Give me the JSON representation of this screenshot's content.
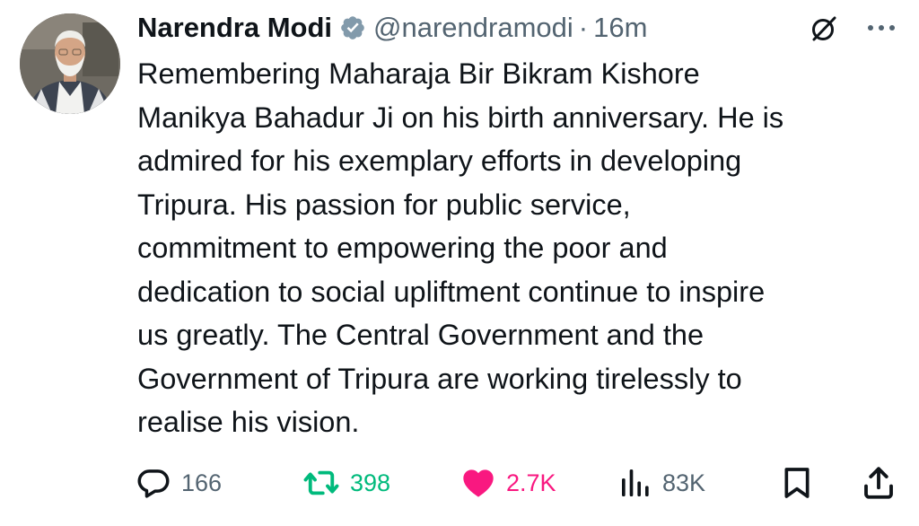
{
  "author": {
    "name": "Narendra Modi",
    "handle": "@narendramodi",
    "separator": "·",
    "timestamp": "16m",
    "verified": true
  },
  "tweet": {
    "lines": [
      "Remembering Maharaja Bir Bikram Kishore",
      "Manikya Bahadur Ji on his birth anniversary. He is",
      "admired for his exemplary efforts in developing",
      "Tripura. His passion for public service,",
      "commitment to empowering the poor and",
      "dedication to social upliftment continue to inspire",
      "us greatly. The Central Government and the",
      "Government of Tripura are working tirelessly to",
      "realise his vision."
    ]
  },
  "actions": {
    "replies": "166",
    "reposts": "398",
    "likes": "2.7K",
    "views": "83K",
    "liked": true
  },
  "colors": {
    "text": "#0f1419",
    "secondary": "#536471",
    "verified_badge": "#829aab",
    "repost": "#00ba7c",
    "like": "#f91880"
  },
  "icons": {
    "reply": "reply-icon",
    "repost": "repost-icon",
    "like": "heart-icon",
    "views": "views-icon",
    "bookmark": "bookmark-icon",
    "share": "share-icon",
    "grok": "grok-icon",
    "more": "more-icon"
  }
}
